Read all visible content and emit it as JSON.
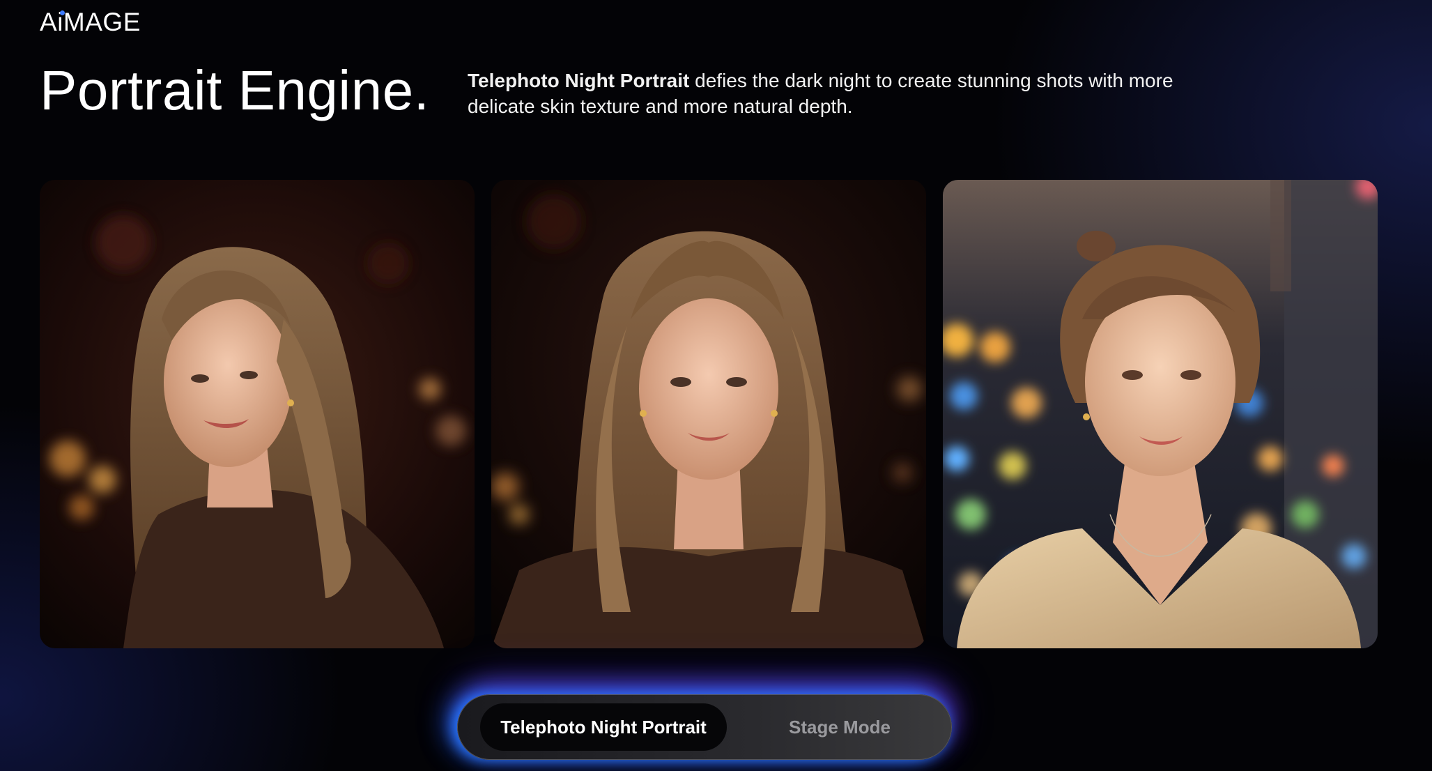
{
  "brand": {
    "logo_text": "AiMAGE"
  },
  "hero": {
    "title": "Portrait Engine.",
    "description_emphasis": "Telephoto Night Portrait",
    "description_rest": " defies the dark night to create stunning shots with more delicate skin texture and more natural depth."
  },
  "gallery": {
    "photos": [
      {
        "subject": "woman looking over shoulder, dark warm bokeh background"
      },
      {
        "subject": "woman facing camera, dark background"
      },
      {
        "subject": "woman with hair up, city night bokeh background"
      }
    ]
  },
  "mode_switch": {
    "options": [
      {
        "label": "Telephoto Night Portrait",
        "selected": true
      },
      {
        "label": "Stage Mode",
        "selected": false
      }
    ]
  },
  "colors": {
    "background": "#030306",
    "accent_glow": "#2b7bff",
    "accent_purple": "#8a3cff",
    "inactive_text": "#9a9a9e"
  }
}
